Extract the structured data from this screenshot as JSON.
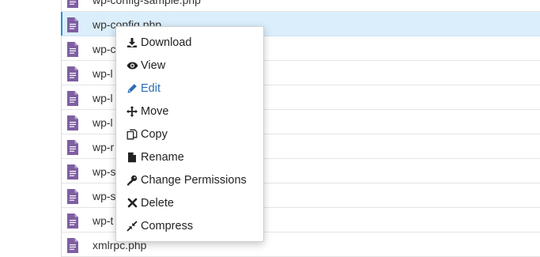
{
  "files": [
    {
      "name": "wp-config-sample.php",
      "selected": false
    },
    {
      "name": "wp-config.php",
      "selected": true
    },
    {
      "name": "wp-c",
      "selected": false
    },
    {
      "name": "wp-l",
      "selected": false
    },
    {
      "name": "wp-l",
      "selected": false
    },
    {
      "name": "wp-l",
      "selected": false
    },
    {
      "name": "wp-r",
      "selected": false
    },
    {
      "name": "wp-s",
      "selected": false
    },
    {
      "name": "wp-s",
      "selected": false
    },
    {
      "name": "wp-t",
      "selected": false
    },
    {
      "name": "xmlrpc.php",
      "selected": false
    }
  ],
  "context_menu": {
    "items": [
      {
        "label": "Download",
        "icon": "download-icon",
        "active": false
      },
      {
        "label": "View",
        "icon": "eye-icon",
        "active": false
      },
      {
        "label": "Edit",
        "icon": "pencil-icon",
        "active": true
      },
      {
        "label": "Move",
        "icon": "move-arrows-icon",
        "active": false
      },
      {
        "label": "Copy",
        "icon": "copy-icon",
        "active": false
      },
      {
        "label": "Rename",
        "icon": "file-icon",
        "active": false
      },
      {
        "label": "Change Permissions",
        "icon": "key-icon",
        "active": false
      },
      {
        "label": "Delete",
        "icon": "x-icon",
        "active": false
      },
      {
        "label": "Compress",
        "icon": "compress-icon",
        "active": false
      }
    ]
  },
  "colors": {
    "file_icon": "#7e5fa1",
    "selected_row": "#dbeefb",
    "active_menu_text": "#2a6cb3",
    "menu_text": "#222222"
  }
}
